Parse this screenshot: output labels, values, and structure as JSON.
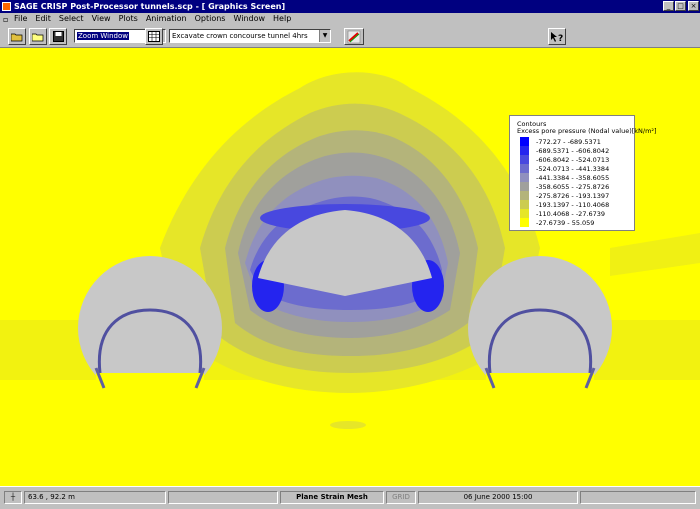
{
  "window": {
    "title": "SAGE CRISP Post-Processor tunnels.scp - [ Graphics Screen]",
    "controls": {
      "minimize": "_",
      "maximize": "□",
      "close": "×"
    }
  },
  "menubar": {
    "items": [
      "File",
      "Edit",
      "Select",
      "View",
      "Plots",
      "Animation",
      "Options",
      "Window",
      "Help"
    ]
  },
  "toolbar": {
    "zoom_select": "Zoom Window",
    "stage_select": "Excavate crown concourse tunnel 4hrs",
    "icons": [
      "open-folder-icon",
      "save-icon",
      "table-grid-icon",
      "sage-logo-icon",
      "help-pointer-icon"
    ]
  },
  "legend": {
    "title": "Contours",
    "subtitle": "Excess pore pressure (Nodal value)[kN/m²]",
    "items": [
      {
        "label": "-772.27 - -689.5371",
        "color": "#0000ff"
      },
      {
        "label": "-689.5371 - -606.8042",
        "color": "#2424ef"
      },
      {
        "label": "-606.8042 - -524.0713",
        "color": "#4848df"
      },
      {
        "label": "-524.0713 - -441.3384",
        "color": "#6c6cce"
      },
      {
        "label": "-441.3384 - -358.6055",
        "color": "#9090be"
      },
      {
        "label": "-358.6055 - -275.8726",
        "color": "#a0a09c"
      },
      {
        "label": "-275.8726 - -193.1397",
        "color": "#b4b47a"
      },
      {
        "label": "-193.1397 - -110.4068",
        "color": "#cccc50"
      },
      {
        "label": "-110.4068 - -27.6739",
        "color": "#e6e628"
      },
      {
        "label": "-27.6739 - 55.059",
        "color": "#ffff00"
      }
    ]
  },
  "colors": {
    "background": "#ffff00",
    "tunnel_fill": "#c8c8c8",
    "lining": "#5050a0"
  },
  "statusbar": {
    "coordinates": "63.6 , 92.2 m",
    "mesh_type": "Plane Strain Mesh",
    "grid": "GRID",
    "datetime": "06 June 2000 15:00"
  }
}
